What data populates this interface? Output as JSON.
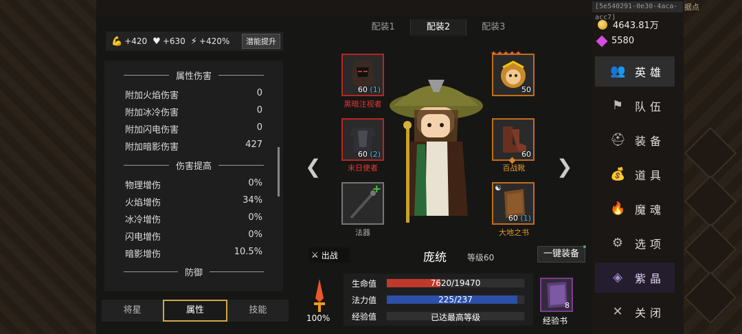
{
  "topbar": {
    "session_id": "[5e540291-0e30-4aca-acc7]",
    "extra": "据点"
  },
  "stat_bar": {
    "strength": "+420",
    "health": "+630",
    "speed": "+420%",
    "boost_label": "潜能提升"
  },
  "stats": {
    "sections": [
      {
        "title": "属性伤害",
        "rows": [
          {
            "label": "附加火焰伤害",
            "value": "0"
          },
          {
            "label": "附加冰冷伤害",
            "value": "0"
          },
          {
            "label": "附加闪电伤害",
            "value": "0"
          },
          {
            "label": "附加暗影伤害",
            "value": "427"
          }
        ]
      },
      {
        "title": "伤害提高",
        "rows": [
          {
            "label": "物理增伤",
            "value": "0%"
          },
          {
            "label": "火焰增伤",
            "value": "34%"
          },
          {
            "label": "冰冷增伤",
            "value": "0%"
          },
          {
            "label": "闪电增伤",
            "value": "0%"
          },
          {
            "label": "暗影增伤",
            "value": "10.5%"
          }
        ]
      },
      {
        "title": "防御",
        "rows": []
      }
    ]
  },
  "bottom_tabs": [
    "将星",
    "属性",
    "技能"
  ],
  "active_bottom_tab": "属性",
  "loadouts": [
    "配装1",
    "配装2",
    "配装3"
  ],
  "active_loadout": "配装2",
  "slots": {
    "top_left": {
      "name": "黑暗注视者",
      "level": "60",
      "bonus": "(1)"
    },
    "top_right": {
      "level": "50",
      "stars": "★★★★★"
    },
    "mid_left": {
      "name": "末日使者",
      "level": "60",
      "bonus": "(2)"
    },
    "mid_right": {
      "name": "百战靴",
      "level": "60"
    },
    "bottom_left": {
      "name": "法器"
    },
    "bottom_right": {
      "name": "大地之书",
      "level": "60",
      "bonus": "(1)"
    }
  },
  "hero": {
    "name": "庞统",
    "level_text": "等级60",
    "fight_label": "出战",
    "equip_all_label": "一键装备"
  },
  "bars": {
    "hp": {
      "label": "生命值",
      "text": "7620/19470",
      "fraction": 0.391,
      "color": "#c0392b"
    },
    "mp": {
      "label": "法力值",
      "text": "225/237",
      "fraction": 0.949,
      "color": "#2c4fa8"
    },
    "exp": {
      "label": "经验值",
      "text": "已达最高等级",
      "fraction": 0,
      "color": "#555"
    }
  },
  "power_pct": "100%",
  "exp_book": {
    "label": "经验书",
    "count": "8"
  },
  "currency": {
    "gold": "4643.81万",
    "gems": "5580"
  },
  "side_menu": [
    {
      "label": "英雄",
      "icon": "heroes-icon"
    },
    {
      "label": "队伍",
      "icon": "flag-icon"
    },
    {
      "label": "装备",
      "icon": "helmet-icon"
    },
    {
      "label": "道具",
      "icon": "bag-icon"
    },
    {
      "label": "魔魂",
      "icon": "flame-icon"
    },
    {
      "label": "选项",
      "icon": "gear-icon"
    },
    {
      "label": "紫晶",
      "icon": "crystal-icon"
    },
    {
      "label": "关闭",
      "icon": "close-icon"
    }
  ]
}
